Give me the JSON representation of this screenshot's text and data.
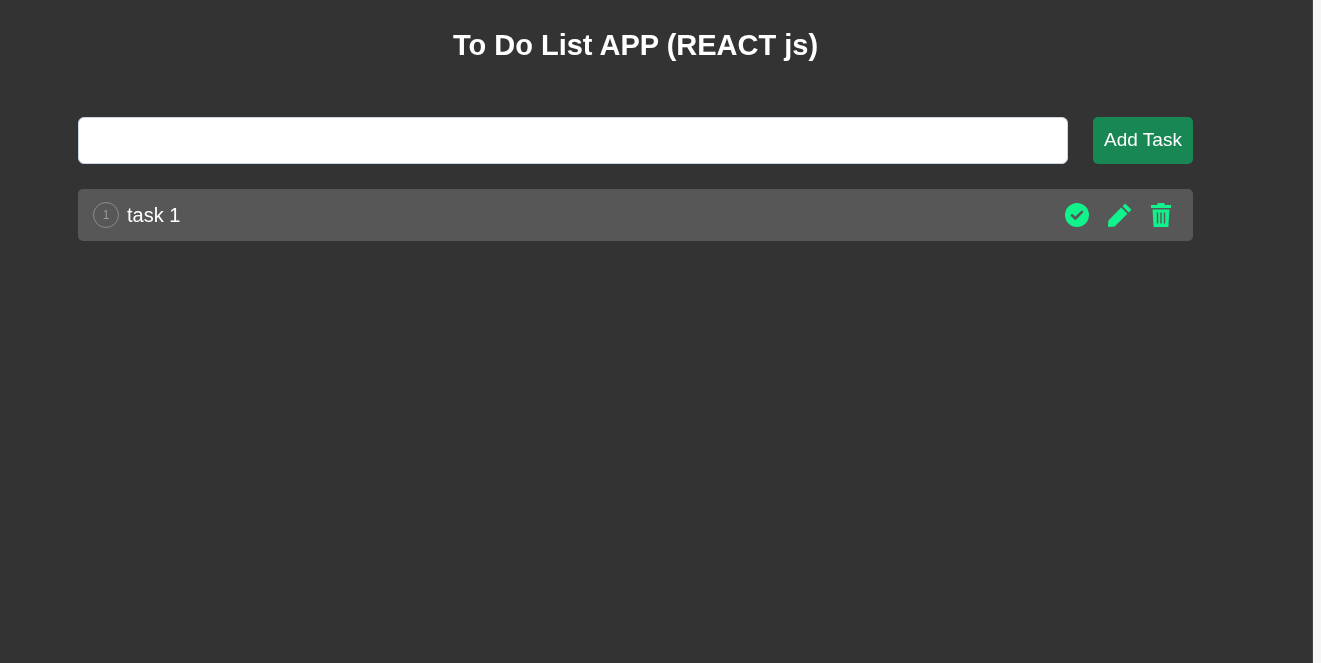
{
  "header": {
    "title": "To Do List APP (REACT js)"
  },
  "new_task_form": {
    "button": "Add Task"
  },
  "tasks": [
    {
      "number": "1",
      "text": "task 1"
    }
  ]
}
